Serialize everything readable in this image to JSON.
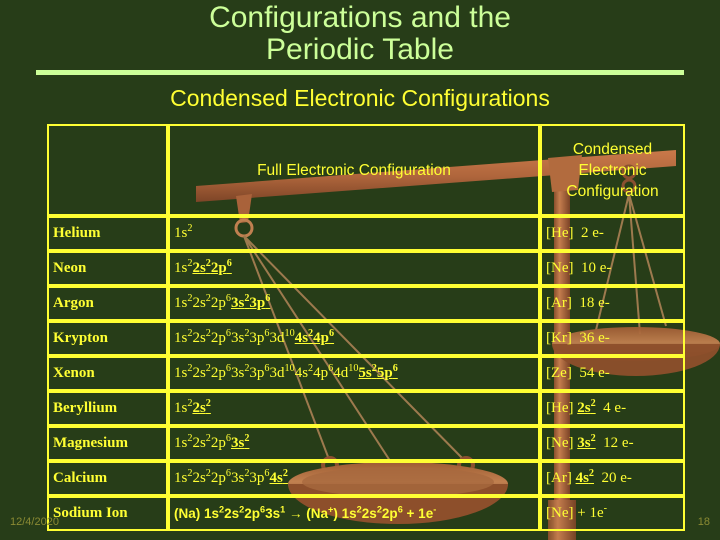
{
  "slide": {
    "title": "Configurations and the Periodic Table",
    "title_line1": "Configurations and the",
    "title_line2": "Periodic Table",
    "subtitle": "Condensed Electronic Configurations",
    "background_color": "#273d18",
    "title_color": "#ccff99",
    "accent_color": "#ffff33",
    "artwork": "balance-scale-image"
  },
  "table": {
    "headers": {
      "col1": "",
      "col2": "Full Electronic Configuration",
      "col3_line1": "Condensed",
      "col3_line2": "Electronic",
      "col3_line3": "Configuration",
      "col3": "Condensed Electronic Configuration"
    },
    "rows": [
      {
        "name": "Helium",
        "full_plain": "1s2",
        "full_parts": [
          {
            "t": "1s",
            "sup": "2",
            "hl": false
          }
        ],
        "condensed_text": "[He]",
        "condensed_parts": [],
        "count": "2 e-"
      },
      {
        "name": "Neon",
        "full_plain": "1s22s22p6",
        "full_parts": [
          {
            "t": "1s",
            "sup": "2",
            "hl": false
          },
          {
            "t": "2s",
            "sup": "2",
            "hl": true
          },
          {
            "t": "2p",
            "sup": "6",
            "hl": true
          }
        ],
        "condensed_text": "[Ne]",
        "condensed_parts": [],
        "count": "10 e-"
      },
      {
        "name": "Argon",
        "full_plain": "1s22s22p63s23p6",
        "full_parts": [
          {
            "t": "1s",
            "sup": "2",
            "hl": false
          },
          {
            "t": "2s",
            "sup": "2",
            "hl": false
          },
          {
            "t": "2p",
            "sup": "6",
            "hl": false
          },
          {
            "t": "3s",
            "sup": "2",
            "hl": true
          },
          {
            "t": "3p",
            "sup": "6",
            "hl": true
          }
        ],
        "condensed_text": "[Ar]",
        "condensed_parts": [],
        "count": "18 e-"
      },
      {
        "name": "Krypton",
        "full_plain": "1s22s22p63s23p63d104s24p6",
        "full_parts": [
          {
            "t": "1s",
            "sup": "2",
            "hl": false
          },
          {
            "t": "2s",
            "sup": "2",
            "hl": false
          },
          {
            "t": "2p",
            "sup": "6",
            "hl": false
          },
          {
            "t": "3s",
            "sup": "2",
            "hl": false
          },
          {
            "t": "3p",
            "sup": "6",
            "hl": false
          },
          {
            "t": "3d",
            "sup": "10",
            "hl": false
          },
          {
            "t": "4s",
            "sup": "2",
            "hl": true
          },
          {
            "t": "4p",
            "sup": "6",
            "hl": true
          }
        ],
        "condensed_text": "[Kr]",
        "condensed_parts": [],
        "count": "36 e-"
      },
      {
        "name": "Xenon",
        "full_plain": "1s22s22p63s23p63d104s24p64d105s25p6",
        "full_parts": [
          {
            "t": "1s",
            "sup": "2",
            "hl": false
          },
          {
            "t": "2s",
            "sup": "2",
            "hl": false
          },
          {
            "t": "2p",
            "sup": "6",
            "hl": false
          },
          {
            "t": "3s",
            "sup": "2",
            "hl": false
          },
          {
            "t": "3p",
            "sup": "6",
            "hl": false
          },
          {
            "t": "3d",
            "sup": "10",
            "hl": false
          },
          {
            "t": "4s",
            "sup": "2",
            "hl": false
          },
          {
            "t": "4p",
            "sup": "6",
            "hl": false
          },
          {
            "t": "4d",
            "sup": "10",
            "hl": false
          },
          {
            "t": "5s",
            "sup": "2",
            "hl": true
          },
          {
            "t": "5p",
            "sup": "6",
            "hl": true
          }
        ],
        "condensed_text": "[Ze]",
        "condensed_parts": [],
        "count": "54 e-"
      },
      {
        "name": "Beryllium",
        "full_plain": "1s22s2",
        "full_parts": [
          {
            "t": "1s",
            "sup": "2",
            "hl": false
          },
          {
            "t": "2s",
            "sup": "2",
            "hl": true
          }
        ],
        "condensed_text": "[He]",
        "condensed_parts": [
          {
            "t": "2s",
            "sup": "2",
            "hl": true
          }
        ],
        "count": "4 e-"
      },
      {
        "name": "Magnesium",
        "full_plain": "1s22s22p63s2",
        "full_parts": [
          {
            "t": "1s",
            "sup": "2",
            "hl": false
          },
          {
            "t": "2s",
            "sup": "2",
            "hl": false
          },
          {
            "t": "2p",
            "sup": "6",
            "hl": false
          },
          {
            "t": "3s",
            "sup": "2",
            "hl": true
          }
        ],
        "condensed_text": "[Ne]",
        "condensed_parts": [
          {
            "t": "3s",
            "sup": "2",
            "hl": true
          }
        ],
        "count": "12 e-"
      },
      {
        "name": "Calcium",
        "full_plain": "1s22s22p63s23p64s2",
        "full_parts": [
          {
            "t": "1s",
            "sup": "2",
            "hl": false
          },
          {
            "t": "2s",
            "sup": "2",
            "hl": false
          },
          {
            "t": "2p",
            "sup": "6",
            "hl": false
          },
          {
            "t": "3s",
            "sup": "2",
            "hl": false
          },
          {
            "t": "3p",
            "sup": "6",
            "hl": false
          },
          {
            "t": "4s",
            "sup": "2",
            "hl": true
          }
        ],
        "condensed_text": "[Ar]",
        "condensed_parts": [
          {
            "t": "4s",
            "sup": "2",
            "hl": true
          }
        ],
        "count": "20 e-"
      },
      {
        "name": "Sodium Ion",
        "sans": true,
        "full_plain": "(Na) 1s22s22p63s1 → (Na+) 1s22s22p6 + 1e-",
        "full_parts": [
          {
            "t": "(Na) 1s",
            "sup": "2",
            "hl": false
          },
          {
            "t": "2s",
            "sup": "2",
            "hl": false
          },
          {
            "t": "2p",
            "sup": "6",
            "hl": false
          },
          {
            "t": "3s",
            "sup": "1",
            "hl": false
          },
          {
            "t": " → (Na",
            "sup": "+",
            "hl": false
          },
          {
            "t": ")  1s",
            "sup": "2",
            "hl": false
          },
          {
            "t": "2s",
            "sup": "2",
            "hl": false
          },
          {
            "t": "2p",
            "sup": "6",
            "hl": false
          },
          {
            "t": " + 1e",
            "sup": "-",
            "hl": false
          }
        ],
        "condensed_text": "[Ne] + 1e",
        "condensed_sup": "-",
        "condensed_parts": [],
        "count": ""
      }
    ]
  },
  "footer": {
    "date": "12/4/2020",
    "page_number": "18"
  }
}
